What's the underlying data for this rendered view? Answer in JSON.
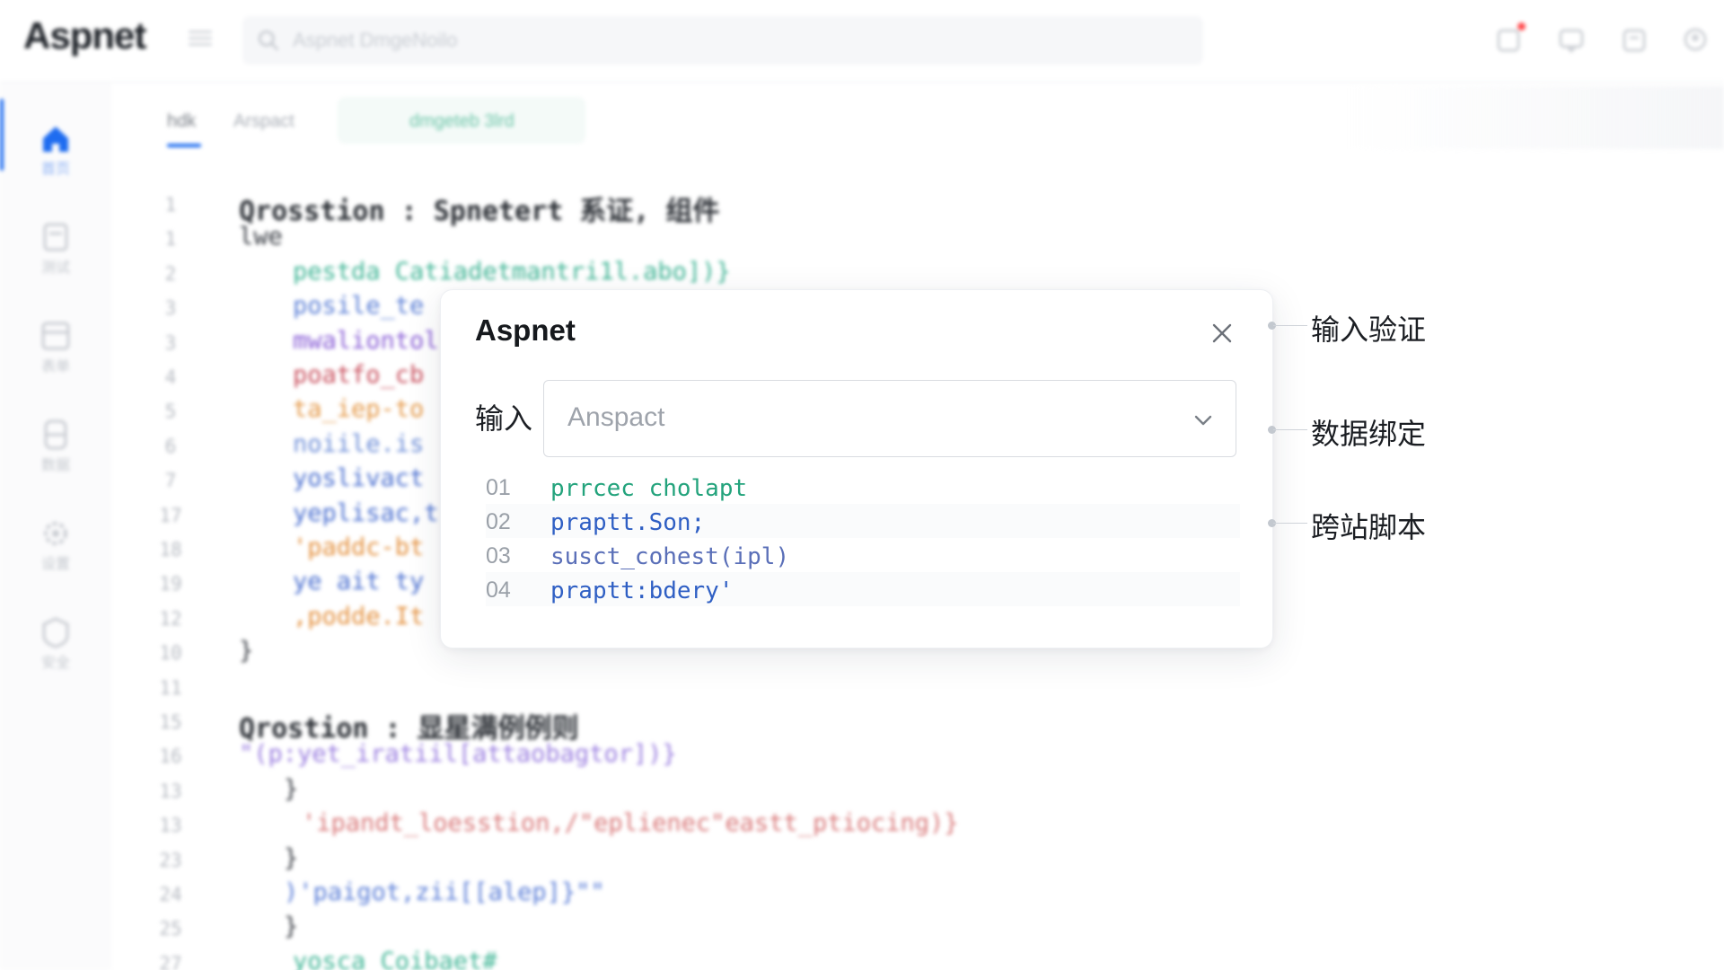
{
  "app": {
    "logo": "Aspnet",
    "search_placeholder": "Aspnet DmgeNoilo"
  },
  "sidebar": {
    "items": [
      {
        "label": "首页",
        "icon": "home-icon"
      },
      {
        "label": "测试",
        "icon": "document-icon"
      },
      {
        "label": "表单",
        "icon": "form-icon"
      },
      {
        "label": "数据",
        "icon": "database-icon"
      },
      {
        "label": "设置",
        "icon": "gear-icon"
      },
      {
        "label": "安全",
        "icon": "shield-icon"
      }
    ]
  },
  "tabs": [
    "hdk",
    "Arspact",
    "dmgeteb 3lrd"
  ],
  "editor": {
    "lines": [
      {
        "num": "1",
        "text": "Qrosstion : Spnetert 系证, 组件",
        "heading": true,
        "indent": 0,
        "color": "#2b2f35"
      },
      {
        "num": "1",
        "text": "lwe",
        "indent": 0,
        "color": "#3a3e45"
      },
      {
        "num": "2",
        "text": "pestda Catiadetmantri1l.abo])}",
        "indent": 60,
        "color": "#3fb595"
      },
      {
        "num": "3",
        "text": "posile_te",
        "indent": 60,
        "color": "#5b7fd6"
      },
      {
        "num": "3",
        "text": "mwaliontol",
        "indent": 60,
        "color": "#8a5fd6"
      },
      {
        "num": "4",
        "text": "poatfo_cb",
        "indent": 60,
        "color": "#c9505e"
      },
      {
        "num": "5",
        "text": "ta_iep-to",
        "indent": 60,
        "color": "#e59a4a"
      },
      {
        "num": "6",
        "text": "noiile.is",
        "indent": 60,
        "color": "#6f8fd8"
      },
      {
        "num": "7",
        "text": "yoslivact",
        "indent": 60,
        "color": "#4a6fd0"
      },
      {
        "num": "17",
        "text": "yeplisac,t",
        "indent": 60,
        "color": "#4a6fd0"
      },
      {
        "num": "18",
        "text": "'paddc-bt",
        "indent": 60,
        "color": "#e4913f"
      },
      {
        "num": "19",
        "text": "ye ait ty",
        "indent": 60,
        "color": "#4a6fd0"
      },
      {
        "num": "12",
        "text": ",podde.It",
        "indent": 60,
        "color": "#e4913f"
      },
      {
        "num": "10",
        "text": "}",
        "indent": 0,
        "color": "#3a3e45"
      },
      {
        "num": "11",
        "text": "",
        "indent": 0,
        "color": "#3a3e45"
      },
      {
        "num": "15",
        "text": "Qrostion : 显星满例例则",
        "heading": true,
        "indent": 0,
        "color": "#2b2f35"
      },
      {
        "num": "16",
        "text": "\"(p:yet_iratiil[attaobagtor])}",
        "indent": 0,
        "color": "#9b7fe0"
      },
      {
        "num": "13",
        "text": "}",
        "indent": 50,
        "color": "#3a3e45"
      },
      {
        "num": "13",
        "text": "'ipandt_loesstion,/\"eplienec\"eastt_ptiocing)}",
        "indent": 70,
        "color": "#d9797a"
      },
      {
        "num": "23",
        "text": "}",
        "indent": 50,
        "color": "#3a3e45"
      },
      {
        "num": "24",
        "text": ")'paigot,zii[[alep]}\"\"",
        "indent": 50,
        "color": "#5c7fd8"
      },
      {
        "num": "25",
        "text": "}",
        "indent": 50,
        "color": "#3a3e45"
      },
      {
        "num": "27",
        "text": "yosca Coibaet#",
        "indent": 60,
        "color": "#3fb595"
      }
    ]
  },
  "modal": {
    "title": "Aspnet",
    "field_label": "输入",
    "select_value": "Anspact",
    "code_lines": [
      {
        "num": "01",
        "text": "prrcec cholapt",
        "color": "#23a37c"
      },
      {
        "num": "02",
        "text": "praptt.Son;",
        "color": "#2f5fc4"
      },
      {
        "num": "03",
        "text": "susct_cohest(ipl)",
        "color": "#5a6fb8",
        "accent": "#d0566a"
      },
      {
        "num": "04",
        "text": "praptt:bdery'",
        "color": "#2f5fc4"
      }
    ]
  },
  "annotations": [
    {
      "text": "输入验证"
    },
    {
      "text": "数据绑定"
    },
    {
      "text": "跨站脚本"
    }
  ]
}
